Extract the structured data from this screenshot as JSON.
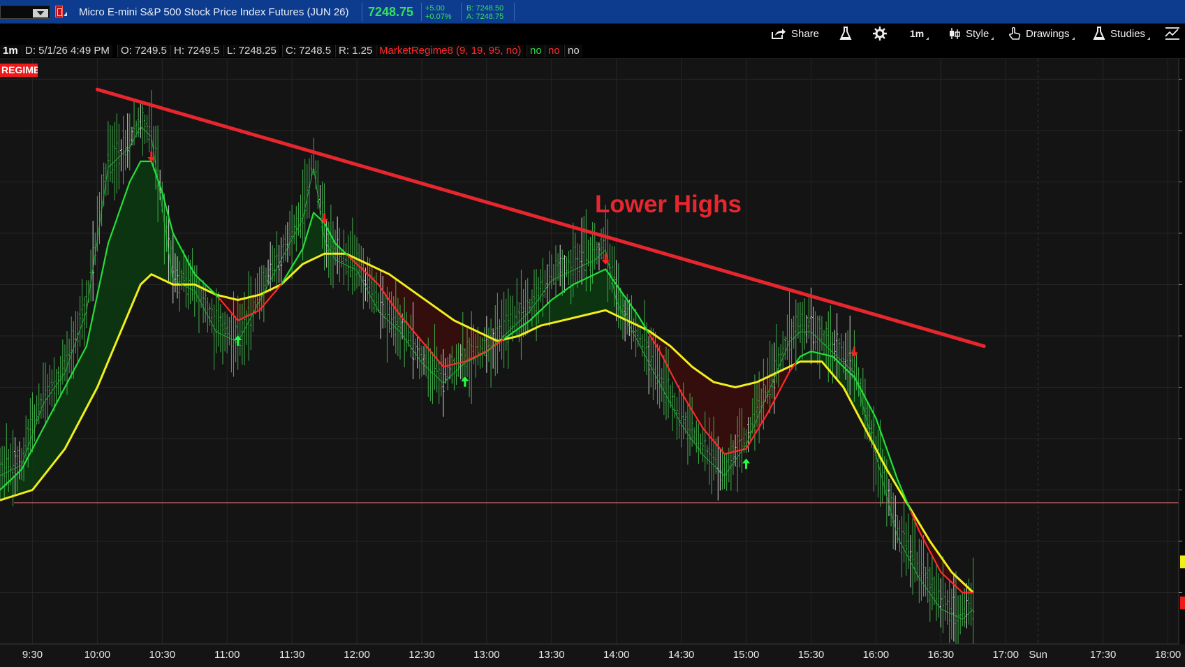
{
  "header": {
    "instrument": "Micro E-mini S&P 500 Stock Price Index Futures (JUN 26)",
    "last_price": "7248.75",
    "change": "+5.00",
    "change_pct": "+0.07%",
    "bid": "B: 7248.50",
    "ask": "A: 7248.75"
  },
  "toolbar": {
    "share": "Share",
    "timeframe": "1m",
    "style": "Style",
    "drawings": "Drawings",
    "studies": "Studies"
  },
  "info": {
    "timeframe": "1m",
    "date": "D: 5/1/26 4:49 PM",
    "open": "O: 7249.5",
    "high": "H: 7249.5",
    "low": "L: 7248.25",
    "close": "C: 7248.5",
    "range": "R: 1.25",
    "study": "MarketRegime8 (9, 19, 95, no)",
    "flag1": "no",
    "flag2": "no",
    "flag3": "no"
  },
  "regime_label": "REGIME",
  "annotation": "Lower Highs",
  "colors": {
    "trendline": "#e8262e",
    "slow_ma": "#f2ee1c",
    "fast_ma_bull": "#22e03a",
    "fast_ma_bear": "#ff2a2a",
    "bull_fill": "#0c3a10",
    "bear_fill": "#3a0c0c",
    "candles": "#3fae4a"
  },
  "chart_data": {
    "type": "line",
    "title": "",
    "xlabel": "",
    "ylabel": "",
    "x_ticks": [
      "9:30",
      "10:00",
      "10:30",
      "11:00",
      "11:30",
      "12:00",
      "12:30",
      "13:00",
      "13:30",
      "14:00",
      "14:30",
      "15:00",
      "15:30",
      "16:00",
      "16:30",
      "17:00",
      "Sun",
      "17:30",
      "18:00"
    ],
    "ylim": [
      7235,
      7292
    ],
    "support_level": 7248.75,
    "price_series": {
      "name": "",
      "x": [
        "9:15",
        "9:25",
        "9:35",
        "9:45",
        "9:55",
        "10:05",
        "10:15",
        "10:20",
        "10:25",
        "10:30",
        "10:35",
        "10:45",
        "10:55",
        "11:05",
        "11:15",
        "11:25",
        "11:35",
        "11:40",
        "11:45",
        "11:50",
        "12:00",
        "12:10",
        "12:20",
        "12:30",
        "12:40",
        "12:50",
        "13:00",
        "13:10",
        "13:20",
        "13:30",
        "13:40",
        "13:50",
        "13:55",
        "14:00",
        "14:10",
        "14:20",
        "14:30",
        "14:40",
        "14:50",
        "15:00",
        "15:10",
        "15:20",
        "15:25",
        "15:30",
        "15:40",
        "15:45",
        "15:50",
        "16:00",
        "16:10",
        "16:20",
        "16:30",
        "16:40",
        "16:45"
      ],
      "y": [
        7252,
        7253,
        7259,
        7262,
        7268,
        7282,
        7284,
        7286,
        7285,
        7278,
        7271,
        7270,
        7266,
        7265,
        7269,
        7273,
        7277,
        7282,
        7275,
        7273,
        7272,
        7268,
        7266,
        7263,
        7261,
        7263,
        7264,
        7266,
        7268,
        7271,
        7272,
        7273,
        7274,
        7269,
        7265,
        7261,
        7257,
        7254,
        7252,
        7255,
        7260,
        7265,
        7266,
        7266,
        7264,
        7263,
        7262,
        7254,
        7246,
        7242,
        7239,
        7238,
        7239
      ]
    },
    "series": [
      {
        "name": "",
        "role": "slow MA",
        "x": [
          "9:15",
          "9:30",
          "9:45",
          "10:00",
          "10:10",
          "10:20",
          "10:25",
          "10:35",
          "10:45",
          "10:55",
          "11:05",
          "11:15",
          "11:25",
          "11:35",
          "11:45",
          "11:55",
          "12:05",
          "12:15",
          "12:25",
          "12:35",
          "12:45",
          "12:55",
          "13:05",
          "13:15",
          "13:25",
          "13:35",
          "13:45",
          "13:55",
          "14:05",
          "14:15",
          "14:25",
          "14:35",
          "14:45",
          "14:55",
          "15:05",
          "15:15",
          "15:25",
          "15:35",
          "15:45",
          "15:55",
          "16:05",
          "16:15",
          "16:25",
          "16:35",
          "16:45"
        ],
        "y": [
          7249,
          7250,
          7254,
          7260,
          7265,
          7270,
          7271,
          7270,
          7270,
          7269,
          7268.5,
          7269,
          7270,
          7272,
          7273,
          7273,
          7272,
          7271,
          7269.5,
          7268,
          7266.5,
          7265.5,
          7264.5,
          7265,
          7266,
          7266.5,
          7267,
          7267.5,
          7266.5,
          7265.5,
          7264,
          7262,
          7260.5,
          7260,
          7260.5,
          7261.5,
          7262.5,
          7262.5,
          7260,
          7256,
          7252,
          7248.5,
          7245,
          7242,
          7240
        ]
      },
      {
        "name": "",
        "role": "fast MA",
        "x": [
          "9:15",
          "9:25",
          "9:35",
          "9:45",
          "9:55",
          "10:05",
          "10:15",
          "10:20",
          "10:25",
          "10:30",
          "10:35",
          "10:45",
          "10:55",
          "11:05",
          "11:15",
          "11:25",
          "11:35",
          "11:40",
          "11:45",
          "11:50",
          "12:00",
          "12:10",
          "12:20",
          "12:30",
          "12:40",
          "12:50",
          "13:00",
          "13:10",
          "13:20",
          "13:30",
          "13:40",
          "13:50",
          "13:55",
          "14:00",
          "14:10",
          "14:20",
          "14:30",
          "14:40",
          "14:50",
          "15:00",
          "15:10",
          "15:20",
          "15:25",
          "15:30",
          "15:40",
          "15:45",
          "15:50",
          "16:00",
          "16:10",
          "16:20",
          "16:30",
          "16:40",
          "16:45"
        ],
        "y": [
          7250,
          7252,
          7256,
          7260,
          7264,
          7274,
          7280,
          7282,
          7282,
          7279,
          7275,
          7271,
          7269,
          7266.5,
          7267.5,
          7270,
          7273.5,
          7277,
          7276,
          7274,
          7272,
          7270,
          7267,
          7264.5,
          7262,
          7262.5,
          7263.5,
          7265,
          7266.5,
          7268.5,
          7270,
          7271,
          7271.5,
          7270,
          7267,
          7263.5,
          7259.5,
          7256,
          7253.5,
          7254,
          7257.5,
          7261.5,
          7263,
          7263.5,
          7263,
          7262,
          7261,
          7257,
          7251,
          7246,
          7242,
          7240,
          7240
        ]
      }
    ],
    "trendline": {
      "start": [
        "10:00",
        7289
      ],
      "end": [
        "16:50",
        7264
      ]
    },
    "signals": [
      {
        "type": "sell",
        "x": "10:25",
        "y": 7282
      },
      {
        "type": "buy",
        "x": "11:05",
        "y": 7265
      },
      {
        "type": "sell",
        "x": "11:45",
        "y": 7276
      },
      {
        "type": "buy",
        "x": "12:50",
        "y": 7261
      },
      {
        "type": "sell",
        "x": "13:55",
        "y": 7272
      },
      {
        "type": "buy",
        "x": "15:00",
        "y": 7253
      },
      {
        "type": "sell",
        "x": "15:50",
        "y": 7263
      }
    ],
    "legend": "none",
    "grid": true
  }
}
